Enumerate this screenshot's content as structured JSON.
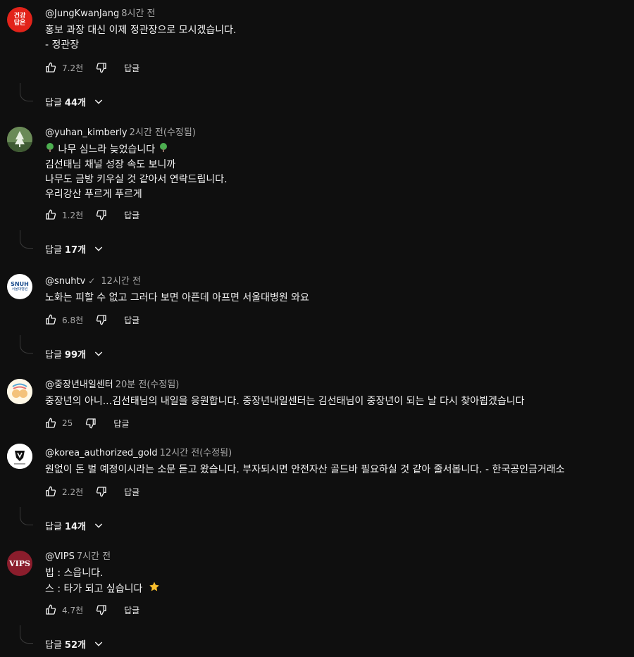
{
  "comments": [
    {
      "author": "@JungKwanJang",
      "time": "8시간 전",
      "lines": [
        "홍보 과장 대신 이제 정관장으로 모시겠습니다.",
        "- 정관장"
      ],
      "likes": "7.2천",
      "reply_label": "답글",
      "replies_prefix": "답글",
      "replies_count": "44개",
      "avatar_text": [
        "건강",
        "답은"
      ],
      "avatar_color": "#e2231a"
    },
    {
      "author": "@yuhan_kimberly",
      "time": "2시간 전(수정됨)",
      "lines": [
        "나무 심느라 늦었습니다",
        "김선태님 채널 성장 속도 보니까",
        "나무도 금방 키우실 것 같아서 연락드립니다.",
        "우리강산 푸르게 푸르게"
      ],
      "likes": "1.2천",
      "reply_label": "답글",
      "replies_prefix": "답글",
      "replies_count": "17개",
      "avatar_color": "#5d7a4a"
    },
    {
      "author": "@snuhtv",
      "verified": "✓",
      "time": "12시간 전",
      "lines": [
        "노화는 피할 수 없고 그러다 보면 아픈데 아프면 서울대병원 와요"
      ],
      "likes": "6.8천",
      "reply_label": "답글",
      "replies_prefix": "답글",
      "replies_count": "99개",
      "avatar_text": [
        "SNUH",
        "서울대병원"
      ],
      "avatar_color": "#ffffff"
    },
    {
      "author": "@중장년내일센터",
      "time": "20분 전(수정됨)",
      "lines": [
        "중장년의 아니...김선태님의 내일을 응원합니다. 중장년내일센터는 김선태님이 중장년이 되는 날 다시 찾아뵙겠습니다"
      ],
      "likes": "25",
      "reply_label": "답글",
      "avatar_color": "#ffffff"
    },
    {
      "author": "@korea_authorized_gold",
      "time": "12시간 전(수정됨)",
      "lines": [
        "원없이 돈 벌 예정이시라는 소문 듣고 왔습니다. 부자되시면 안전자산 골드바 필요하실 것 같아 줄서봅니다. - 한국공인금거래소"
      ],
      "likes": "2.2천",
      "reply_label": "답글",
      "replies_prefix": "답글",
      "replies_count": "14개",
      "avatar_color": "#ffffff"
    },
    {
      "author": "@VIPS",
      "time": "7시간 전",
      "lines": [
        "빕 : 스읍니다.",
        "스 : 타가 되고 싶습니다"
      ],
      "likes": "4.7천",
      "reply_label": "답글",
      "replies_prefix": "답글",
      "replies_count": "52개",
      "avatar_text": [
        "VIPS"
      ],
      "avatar_color": "#8b1d2c"
    }
  ]
}
